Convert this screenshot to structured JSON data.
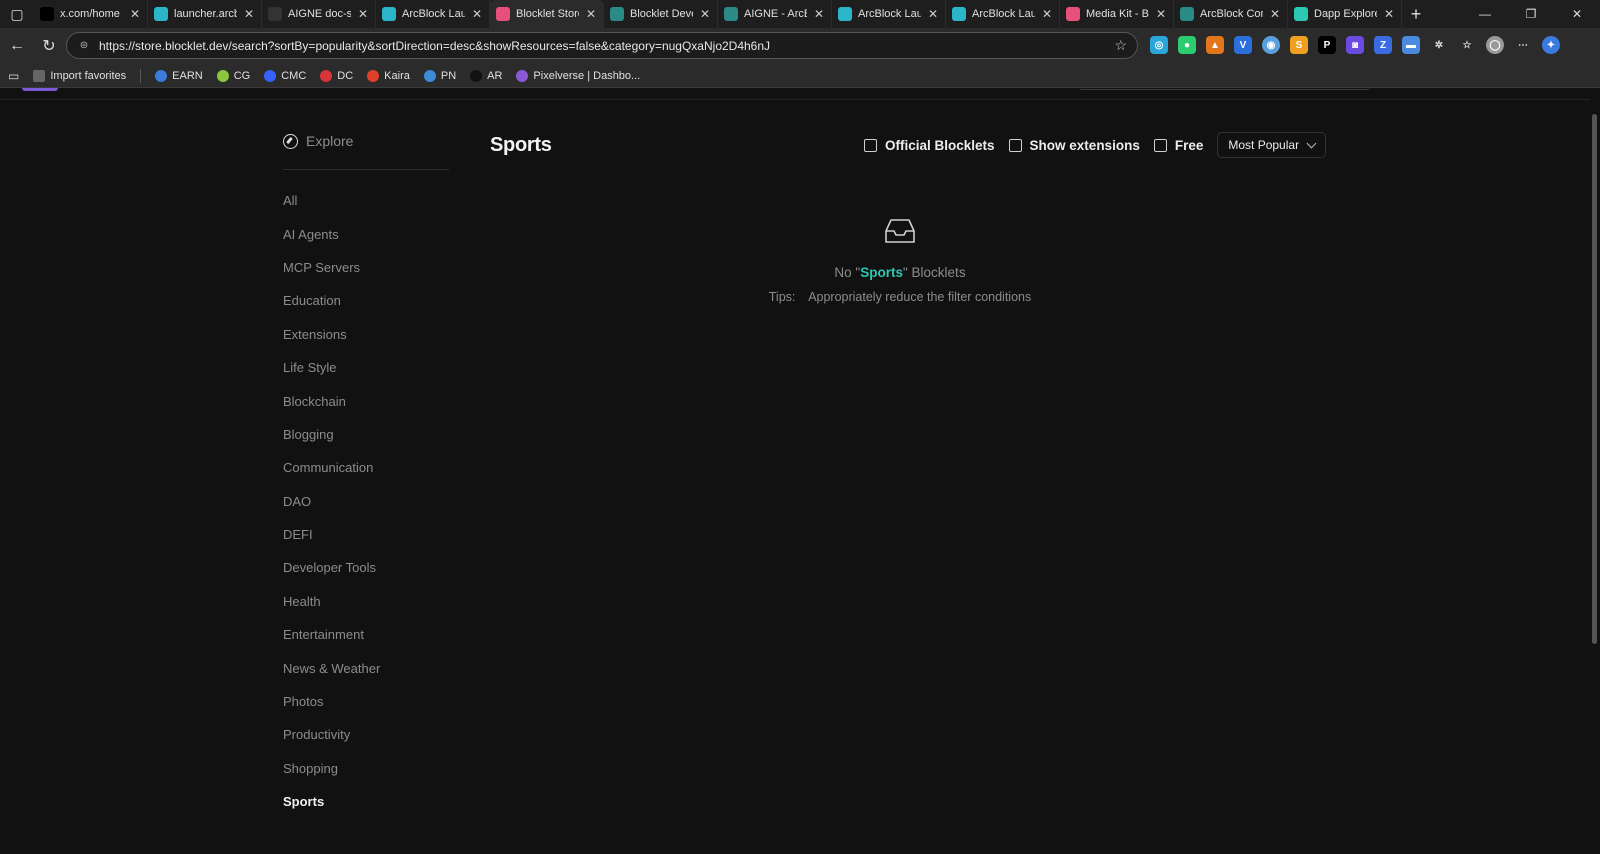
{
  "browser": {
    "tabs": [
      {
        "title": "x.com/home",
        "icon": "x-logo-icon",
        "color": "#000000",
        "active": false
      },
      {
        "title": "launcher.arcbl",
        "icon": "arcblock-launcher-icon",
        "color": "#2bb5c9",
        "active": false
      },
      {
        "title": "AIGNE doc-sm",
        "icon": "github-icon",
        "color": "#333333",
        "active": false
      },
      {
        "title": "ArcBlock Launc",
        "icon": "arcblock-launcher-icon",
        "color": "#2bb5c9",
        "active": false
      },
      {
        "title": "Blocklet Store",
        "icon": "blocklet-store-icon",
        "color": "#e8507c",
        "active": true
      },
      {
        "title": "Blocklet Develo",
        "icon": "blocklet-dev-icon",
        "color": "#2a8b86",
        "active": false
      },
      {
        "title": "AIGNE - ArcBlo",
        "icon": "aigne-icon",
        "color": "#2a8b86",
        "active": false
      },
      {
        "title": "ArcBlock Launc",
        "icon": "arcblock-launcher-icon",
        "color": "#2bb5c9",
        "active": false
      },
      {
        "title": "ArcBlock Launc",
        "icon": "arcblock-launcher-icon",
        "color": "#2bb5c9",
        "active": false
      },
      {
        "title": "Media Kit - Blo",
        "icon": "media-kit-icon",
        "color": "#e8507c",
        "active": false
      },
      {
        "title": "ArcBlock Comm",
        "icon": "arcblock-community-icon",
        "color": "#2a8b86",
        "active": false
      },
      {
        "title": "Dapp Explore",
        "icon": "dapp-explore-icon",
        "color": "#2bc8b4",
        "active": false
      }
    ],
    "url": "https://store.blocklet.dev/search?sortBy=popularity&sortDirection=desc&showResources=false&category=nugQxaNjo2D4h6nJ",
    "bookmarks": [
      {
        "label": "Import favorites",
        "icon": "import-folder-icon",
        "color": "#666666"
      },
      {
        "label": "EARN",
        "icon": "earn-icon",
        "color": "#3b7bd9"
      },
      {
        "label": "CG",
        "icon": "coingecko-icon",
        "color": "#8dc63f"
      },
      {
        "label": "CMC",
        "icon": "coinmarketcap-icon",
        "color": "#3861fb"
      },
      {
        "label": "DC",
        "icon": "dc-icon",
        "color": "#d9343a"
      },
      {
        "label": "Kaira",
        "icon": "kaira-icon",
        "color": "#e0402a"
      },
      {
        "label": "PN",
        "icon": "pn-icon",
        "color": "#3b8bd9"
      },
      {
        "label": "AR",
        "icon": "ar-icon",
        "color": "#111111"
      },
      {
        "label": "Pixelverse | Dashbo...",
        "icon": "pixelverse-icon",
        "color": "#8a5ad6"
      }
    ]
  },
  "sidebar": {
    "explore_label": "Explore",
    "categories": [
      "All",
      "AI Agents",
      "MCP Servers",
      "Education",
      "Extensions",
      "Life Style",
      "Blockchain",
      "Blogging",
      "Communication",
      "DAO",
      "DEFI",
      "Developer Tools",
      "Health",
      "Entertainment",
      "News & Weather",
      "Photos",
      "Productivity",
      "Shopping",
      "Sports"
    ],
    "active_category": "Sports"
  },
  "main": {
    "title": "Sports",
    "filters": {
      "official": "Official Blocklets",
      "extensions": "Show extensions",
      "free": "Free"
    },
    "sort_label": "Most Popular",
    "empty": {
      "prefix": "No \"",
      "highlight": "Sports",
      "suffix": "\" Blocklets",
      "tip_label": "Tips:",
      "tip_text": "Appropriately reduce the filter conditions"
    }
  },
  "colors": {
    "accent": "#2bc8b4",
    "background": "#111111"
  }
}
